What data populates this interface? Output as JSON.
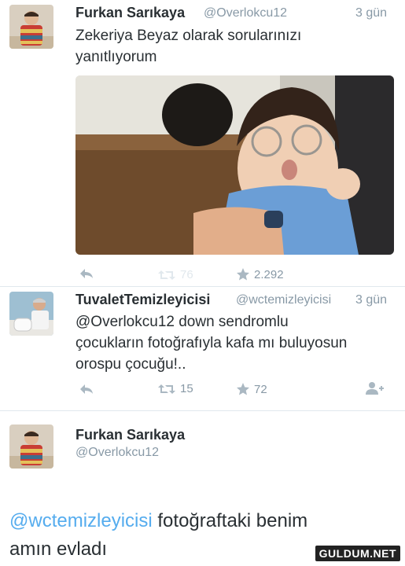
{
  "tweet1": {
    "name": "Furkan Sarıkaya",
    "handle": "@Overlokcu12",
    "time": "3 gün",
    "text_line1": "Zekeriya Beyaz olarak sorularınızı",
    "text_line2": "yanıtlıyorum",
    "retweets": "76",
    "likes": "2.292"
  },
  "tweet2": {
    "name": "TuvaletTemizleyicisi",
    "handle": "@wctemizleyicisi",
    "time": "3 gün",
    "text_line1": "@Overlokcu12 down sendromlu",
    "text_line2": "çocukların fotoğrafıyla kafa mı buluyosun",
    "text_line3": "orospu çocuğu!..",
    "retweets": "15",
    "likes": "72"
  },
  "tweet3": {
    "name": "Furkan Sarıkaya",
    "handle": "@Overlokcu12",
    "mention": "@wctemizleyicisi",
    "text_rest": " fotoğraftaki benim",
    "text_line2": "amın evladı"
  },
  "watermark": "GULDUM.NET",
  "colors": {
    "accent": "#55acee",
    "muted": "#8899a6",
    "icon": "#aab8c2",
    "text": "#292f33"
  },
  "icons": [
    "reply-icon",
    "retweet-icon",
    "like-star-icon",
    "follow-user-icon"
  ]
}
